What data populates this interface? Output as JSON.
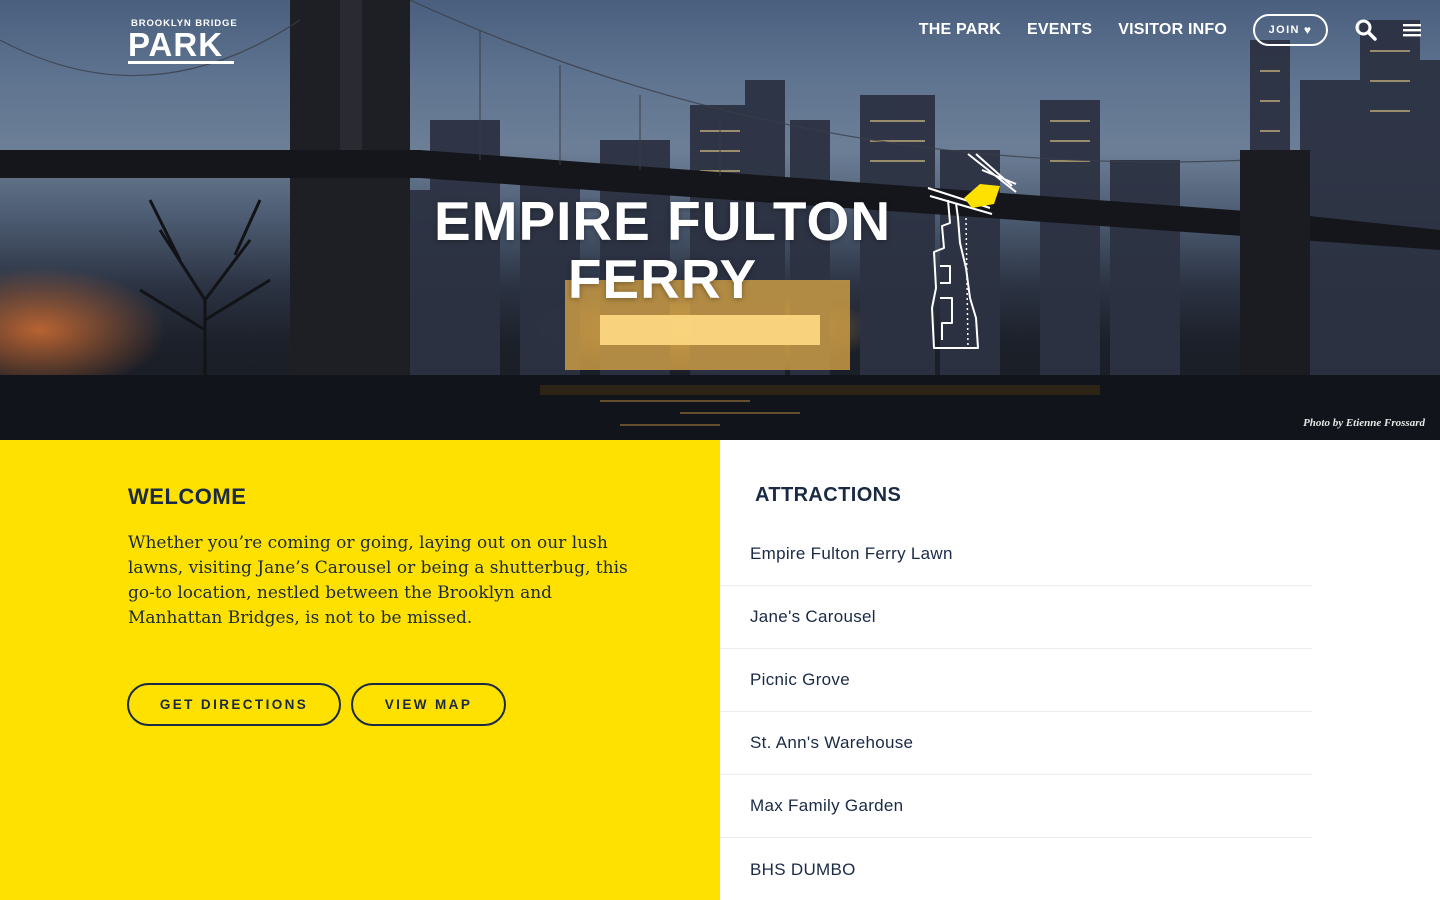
{
  "header": {
    "logo_small": "BROOKLYN BRIDGE",
    "logo_big": "PARK",
    "nav": [
      "THE PARK",
      "EVENTS",
      "VISITOR INFO"
    ],
    "join_label": "JOIN",
    "join_icon": "heart-icon",
    "search_icon": "search-icon",
    "menu_icon": "hamburger-menu-icon"
  },
  "hero": {
    "title_line1": "EMPIRE FULTON",
    "title_line2": "FERRY",
    "photo_credit": "Photo by Etienne Frossard",
    "map_icon": "park-location-map-icon"
  },
  "welcome": {
    "heading": "WELCOME",
    "body": "Whether you’re coming or going, laying out on our lush lawns, visiting Jane’s Carousel or being a shutterbug, this go-to location, nestled between the Brooklyn and Manhattan Bridges, is not to be missed.",
    "directions_label": "GET DIRECTIONS",
    "map_label": "VIEW MAP",
    "background_color": "#ffe100"
  },
  "attractions": {
    "heading": "ATTRACTIONS",
    "items": [
      "Empire Fulton Ferry Lawn",
      "Jane's Carousel",
      "Picnic Grove",
      "St. Ann's Warehouse",
      "Max Family Garden",
      "BHS DUMBO"
    ]
  },
  "colors": {
    "navy": "#1a2a45",
    "accent_yellow": "#ffe100"
  }
}
